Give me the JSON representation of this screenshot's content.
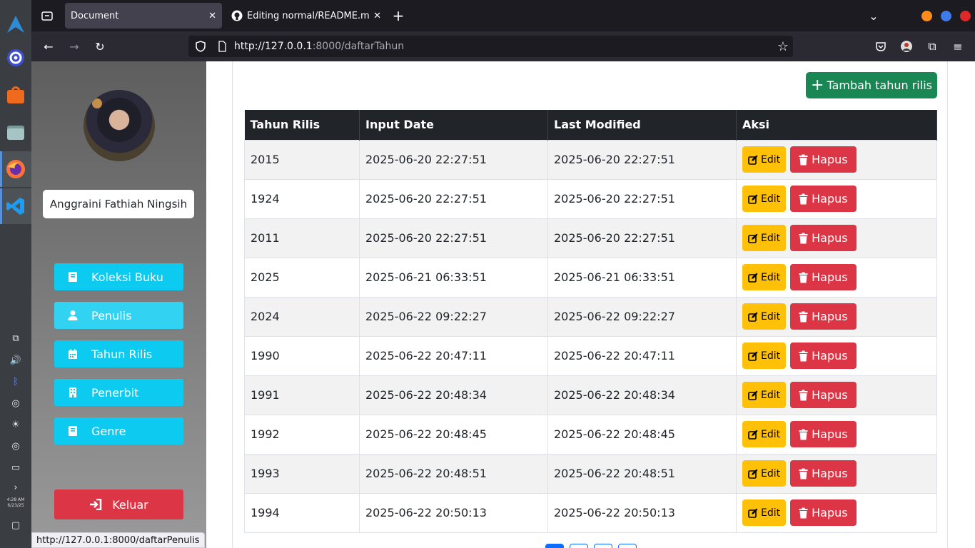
{
  "browser": {
    "tabs": [
      {
        "title": "Document"
      },
      {
        "title": "Editing normal/README.m"
      }
    ],
    "url_host": "http://127.0.0.1",
    "url_path": ":8000/daftarTahun",
    "status_link": "http://127.0.0.1:8000/daftarPenulis"
  },
  "os": {
    "clock_time": "4:28 AM",
    "clock_date": "6/23/25"
  },
  "sidebar": {
    "user_name": "Anggraini Fathiah Ningsih",
    "items": [
      {
        "label": "Koleksi Buku",
        "icon": "book-icon"
      },
      {
        "label": "Penulis",
        "icon": "user-icon"
      },
      {
        "label": "Tahun Rilis",
        "icon": "calendar-icon"
      },
      {
        "label": "Penerbit",
        "icon": "building-icon"
      },
      {
        "label": "Genre",
        "icon": "book-icon"
      }
    ],
    "logout_label": "Keluar"
  },
  "main": {
    "add_button": "Tambah tahun rilis",
    "table": {
      "headers": [
        "Tahun Rilis",
        "Input Date",
        "Last Modified",
        "Aksi"
      ],
      "edit_label": "Edit",
      "delete_label": "Hapus",
      "rows": [
        {
          "tahun": "2015",
          "input": "2025-06-20 22:27:51",
          "modified": "2025-06-20 22:27:51"
        },
        {
          "tahun": "1924",
          "input": "2025-06-20 22:27:51",
          "modified": "2025-06-20 22:27:51"
        },
        {
          "tahun": "2011",
          "input": "2025-06-20 22:27:51",
          "modified": "2025-06-20 22:27:51"
        },
        {
          "tahun": "2025",
          "input": "2025-06-21 06:33:51",
          "modified": "2025-06-21 06:33:51"
        },
        {
          "tahun": "2024",
          "input": "2025-06-22 09:22:27",
          "modified": "2025-06-22 09:22:27"
        },
        {
          "tahun": "1990",
          "input": "2025-06-22 20:47:11",
          "modified": "2025-06-22 20:47:11"
        },
        {
          "tahun": "1991",
          "input": "2025-06-22 20:48:34",
          "modified": "2025-06-22 20:48:34"
        },
        {
          "tahun": "1992",
          "input": "2025-06-22 20:48:45",
          "modified": "2025-06-22 20:48:45"
        },
        {
          "tahun": "1993",
          "input": "2025-06-22 20:48:51",
          "modified": "2025-06-22 20:48:51"
        },
        {
          "tahun": "1994",
          "input": "2025-06-22 20:50:13",
          "modified": "2025-06-22 20:50:13"
        }
      ]
    }
  },
  "colors": {
    "accent_info": "#0dcaf0",
    "success": "#198754",
    "warning": "#ffc107",
    "danger": "#dc3545",
    "table_header": "#212529"
  }
}
